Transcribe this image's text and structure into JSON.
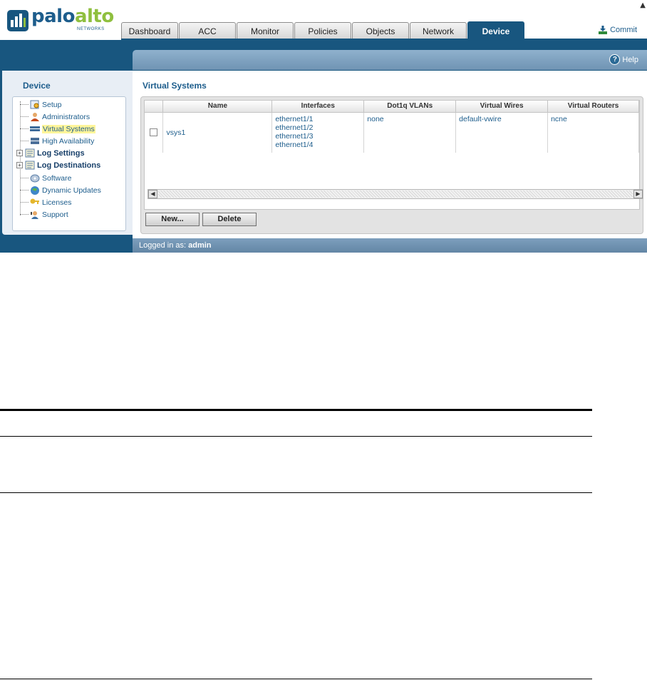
{
  "brand": {
    "logo_palo": "palo",
    "logo_alto": "alto",
    "logo_sub": "NETWORKS",
    "colors": {
      "brand_blue": "#18567f",
      "logo_green": "#8fbf3f",
      "link_blue": "#1d5d8c",
      "alert_red": "#cc1111"
    }
  },
  "tabs": [
    {
      "label": "Dashboard",
      "active": false
    },
    {
      "label": "ACC",
      "active": false
    },
    {
      "label": "Monitor",
      "active": false
    },
    {
      "label": "Policies",
      "active": false
    },
    {
      "label": "Objects",
      "active": false
    },
    {
      "label": "Network",
      "active": false
    },
    {
      "label": "Device",
      "active": true
    }
  ],
  "toolbar": {
    "commit_label": "Commit",
    "commit_icon": "commit-download-icon",
    "help_label": "Help",
    "help_icon": "help-icon"
  },
  "sidebar": {
    "title": "Device",
    "items": [
      {
        "label": "Setup",
        "icon": "setup-icon",
        "selected": false,
        "bold": false,
        "expandable": false
      },
      {
        "label": "Administrators",
        "icon": "administrators-icon",
        "selected": false,
        "bold": false,
        "expandable": false
      },
      {
        "label": "Virtual Systems",
        "icon": "virtual-systems-icon",
        "selected": true,
        "bold": false,
        "expandable": false
      },
      {
        "label": "High Availability",
        "icon": "high-availability-icon",
        "selected": false,
        "bold": false,
        "expandable": false
      },
      {
        "label": "Log Settings",
        "icon": "log-settings-icon",
        "selected": false,
        "bold": true,
        "expandable": true
      },
      {
        "label": "Log Destinations",
        "icon": "log-destinations-icon",
        "selected": false,
        "bold": true,
        "expandable": true
      },
      {
        "label": "Software",
        "icon": "software-icon",
        "selected": false,
        "bold": false,
        "expandable": false
      },
      {
        "label": "Dynamic Updates",
        "icon": "dynamic-updates-icon",
        "selected": false,
        "bold": false,
        "expandable": false
      },
      {
        "label": "Licenses",
        "icon": "licenses-icon",
        "selected": false,
        "bold": false,
        "expandable": false
      },
      {
        "label": "Support",
        "icon": "support-icon",
        "selected": false,
        "bold": false,
        "expandable": false
      }
    ]
  },
  "main": {
    "title": "Virtual Systems",
    "columns": [
      "Name",
      "Interfaces",
      "Dot1q VLANs",
      "Virtual Wires",
      "Virtual Routers"
    ],
    "rows": [
      {
        "name": "vsys1",
        "interfaces": [
          "ethernet1/1",
          "ethernet1/2",
          "ethernet1/3",
          "ethernet1/4"
        ],
        "vlans": "none",
        "wires": "default-vwire",
        "routers": "ncne"
      }
    ],
    "buttons": {
      "new_label": "New...",
      "delete_label": "Delete"
    }
  },
  "status": {
    "prefix": "Logged in as:",
    "user": "admin"
  }
}
